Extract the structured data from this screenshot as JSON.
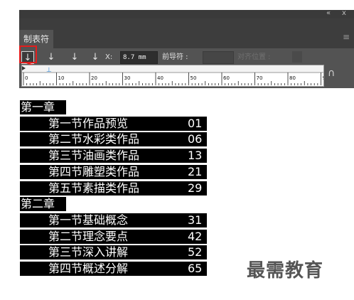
{
  "panel": {
    "collapse_glyph": "«",
    "close_glyph": "x",
    "menu_glyph": "≡",
    "tab_label": "制表符",
    "toolbar": {
      "btn_left_glyph": "↓",
      "btn_center_glyph": "↓",
      "btn_right_glyph": "↓",
      "btn_decimal_glyph": "↓",
      "x_label": "X:",
      "x_value": "8.7 mm",
      "leader_label": "前导符 :",
      "leader_value": "",
      "align_label": "对齐位置 :",
      "align_value": ""
    },
    "ruler": {
      "labels": [
        "0",
        "10",
        "20",
        "30",
        "40",
        "50",
        "60",
        "70",
        "80",
        "9"
      ],
      "tab_marker_glyph": "⊥"
    },
    "magnet_glyph": "∩"
  },
  "toc": [
    {
      "type": "chapter",
      "title": "第一章"
    },
    {
      "type": "section",
      "title": "第一节作品预览",
      "page": "01"
    },
    {
      "type": "section",
      "title": "第二节水彩类作品",
      "page": "06"
    },
    {
      "type": "section",
      "title": "第三节油画类作品",
      "page": "13"
    },
    {
      "type": "section",
      "title": "第四节雕塑类作品",
      "page": "21"
    },
    {
      "type": "section",
      "title": "第五节素描类作品",
      "page": "29"
    },
    {
      "type": "chapter",
      "title": "第二章"
    },
    {
      "type": "section",
      "title": "第一节基础概念",
      "page": "31"
    },
    {
      "type": "section",
      "title": "第二节理念要点",
      "page": "42"
    },
    {
      "type": "section",
      "title": "第三节深入讲解",
      "page": "52"
    },
    {
      "type": "section",
      "title": "第四节概述分解",
      "page": "65"
    }
  ],
  "watermark": "最需教育",
  "colors": {
    "panel_bg": "#535353",
    "highlight": "#e21e1e",
    "toc_bg": "#000000",
    "toc_text": "#ffffff"
  }
}
